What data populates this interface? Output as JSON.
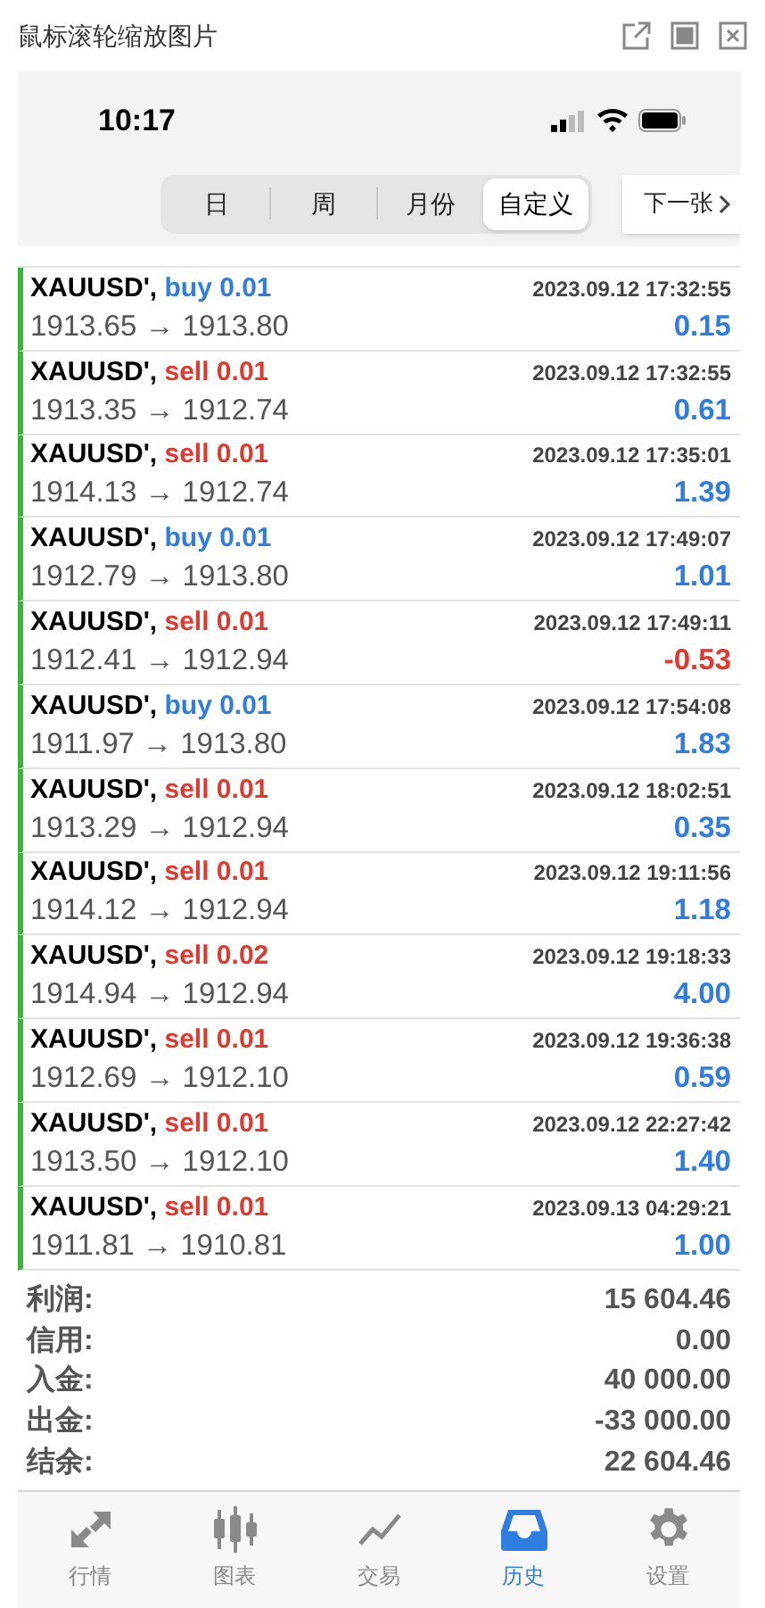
{
  "window": {
    "title": "鼠标滚轮缩放图片"
  },
  "status_bar": {
    "time": "10:17"
  },
  "period_tabs": [
    {
      "label": "日",
      "selected": false
    },
    {
      "label": "周",
      "selected": false
    },
    {
      "label": "月份",
      "selected": false
    },
    {
      "label": "自定义",
      "selected": true
    }
  ],
  "next_button": {
    "label": "下一张"
  },
  "deals": [
    {
      "symbol": "XAUUSD',",
      "order": "buy 0.01",
      "kind": "buy",
      "time": "2023.09.12 17:32:55",
      "prices": "1913.65 → 1913.80",
      "profit": "0.15",
      "loss": false
    },
    {
      "symbol": "XAUUSD',",
      "order": "sell 0.01",
      "kind": "sell",
      "time": "2023.09.12 17:32:55",
      "prices": "1913.35 → 1912.74",
      "profit": "0.61",
      "loss": false
    },
    {
      "symbol": "XAUUSD',",
      "order": "sell 0.01",
      "kind": "sell",
      "time": "2023.09.12 17:35:01",
      "prices": "1914.13 → 1912.74",
      "profit": "1.39",
      "loss": false
    },
    {
      "symbol": "XAUUSD',",
      "order": "buy 0.01",
      "kind": "buy",
      "time": "2023.09.12 17:49:07",
      "prices": "1912.79 → 1913.80",
      "profit": "1.01",
      "loss": false
    },
    {
      "symbol": "XAUUSD',",
      "order": "sell 0.01",
      "kind": "sell",
      "time": "2023.09.12 17:49:11",
      "prices": "1912.41 → 1912.94",
      "profit": "-0.53",
      "loss": true
    },
    {
      "symbol": "XAUUSD',",
      "order": "buy 0.01",
      "kind": "buy",
      "time": "2023.09.12 17:54:08",
      "prices": "1911.97 → 1913.80",
      "profit": "1.83",
      "loss": false
    },
    {
      "symbol": "XAUUSD',",
      "order": "sell 0.01",
      "kind": "sell",
      "time": "2023.09.12 18:02:51",
      "prices": "1913.29 → 1912.94",
      "profit": "0.35",
      "loss": false
    },
    {
      "symbol": "XAUUSD',",
      "order": "sell 0.01",
      "kind": "sell",
      "time": "2023.09.12 19:11:56",
      "prices": "1914.12 → 1912.94",
      "profit": "1.18",
      "loss": false
    },
    {
      "symbol": "XAUUSD',",
      "order": "sell 0.02",
      "kind": "sell",
      "time": "2023.09.12 19:18:33",
      "prices": "1914.94 → 1912.94",
      "profit": "4.00",
      "loss": false
    },
    {
      "symbol": "XAUUSD',",
      "order": "sell 0.01",
      "kind": "sell",
      "time": "2023.09.12 19:36:38",
      "prices": "1912.69 → 1912.10",
      "profit": "0.59",
      "loss": false
    },
    {
      "symbol": "XAUUSD',",
      "order": "sell 0.01",
      "kind": "sell",
      "time": "2023.09.12 22:27:42",
      "prices": "1913.50 → 1912.10",
      "profit": "1.40",
      "loss": false
    },
    {
      "symbol": "XAUUSD',",
      "order": "sell 0.01",
      "kind": "sell",
      "time": "2023.09.13 04:29:21",
      "prices": "1911.81 → 1910.81",
      "profit": "1.00",
      "loss": false
    }
  ],
  "summary": [
    {
      "label": "利润:",
      "value": "15 604.46"
    },
    {
      "label": "信用:",
      "value": "0.00"
    },
    {
      "label": "入金:",
      "value": "40 000.00"
    },
    {
      "label": "出金:",
      "value": "-33 000.00"
    },
    {
      "label": "结余:",
      "value": "22 604.46"
    }
  ],
  "tab_bar": [
    {
      "label": "行情",
      "kind": "quotes",
      "selected": false
    },
    {
      "label": "图表",
      "kind": "chart",
      "selected": false
    },
    {
      "label": "交易",
      "kind": "trade",
      "selected": false
    },
    {
      "label": "历史",
      "kind": "history",
      "selected": true
    },
    {
      "label": "设置",
      "kind": "settings",
      "selected": false
    }
  ]
}
